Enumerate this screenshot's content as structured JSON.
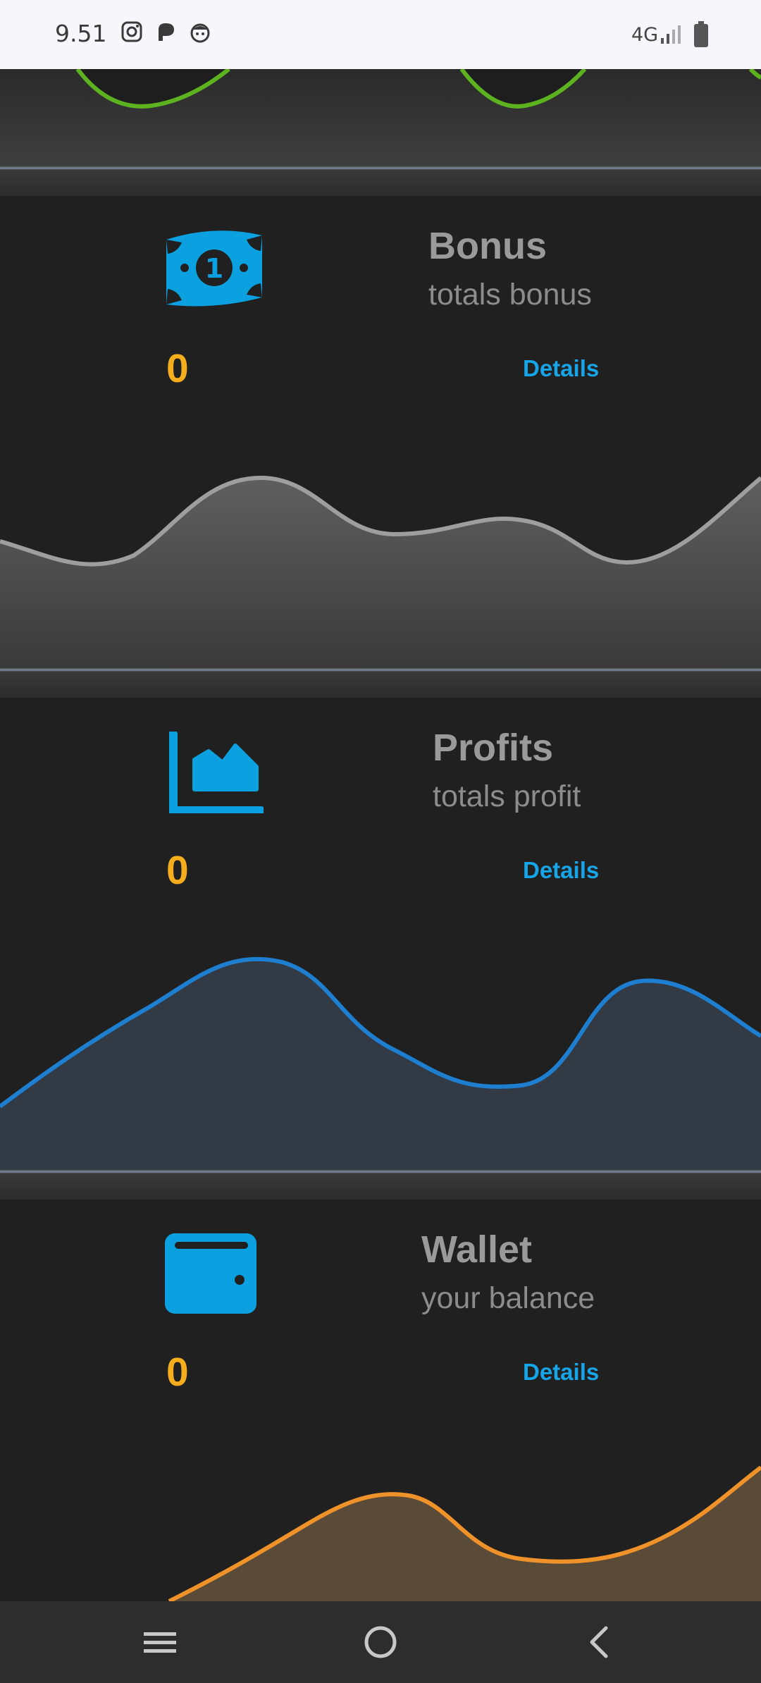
{
  "status_bar": {
    "time": "9.51",
    "network": "4G",
    "icons": [
      "instagram-icon",
      "app-p-icon",
      "app-face-icon",
      "signal-icon",
      "battery-icon"
    ]
  },
  "cards": [
    {
      "id": "bonus",
      "icon": "money-bill-icon",
      "title": "Bonus",
      "subtitle": "totals bonus",
      "value": "0",
      "link": "Details",
      "chart_color": "#9e9e9e"
    },
    {
      "id": "profits",
      "icon": "area-chart-icon",
      "title": "Profits",
      "subtitle": "totals profit",
      "value": "0",
      "link": "Details",
      "chart_color": "#1e7fd0"
    },
    {
      "id": "wallet",
      "icon": "wallet-icon",
      "title": "Wallet",
      "subtitle": "your balance",
      "value": "0",
      "link": "Details",
      "chart_color": "#f0922a"
    }
  ],
  "colors": {
    "accent": "#16a5e8",
    "value": "#f6ad1b",
    "top_chart_line": "#5cb31f"
  },
  "navbar": {
    "buttons": [
      "menu-icon",
      "home-icon",
      "back-icon"
    ]
  }
}
